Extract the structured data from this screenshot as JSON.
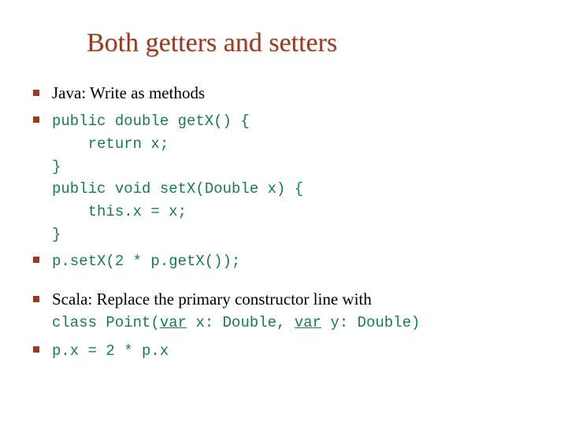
{
  "title": "Both getters and setters",
  "items": {
    "java_heading": "Java: Write as methods",
    "java_code": "public double getX() {\n    return x;\n}\npublic void setX(Double x) {\n    this.x = x;\n}",
    "java_usage": "p.setX(2 * p.getX());",
    "scala_heading": "Scala: Replace the primary constructor line with",
    "scala_code_prefix": "class Point(",
    "scala_var1": "var",
    "scala_code_mid": " x: Double, ",
    "scala_var2": "var",
    "scala_code_suffix": " y: Double)",
    "scala_usage": "p.x = 2 * p.x"
  }
}
